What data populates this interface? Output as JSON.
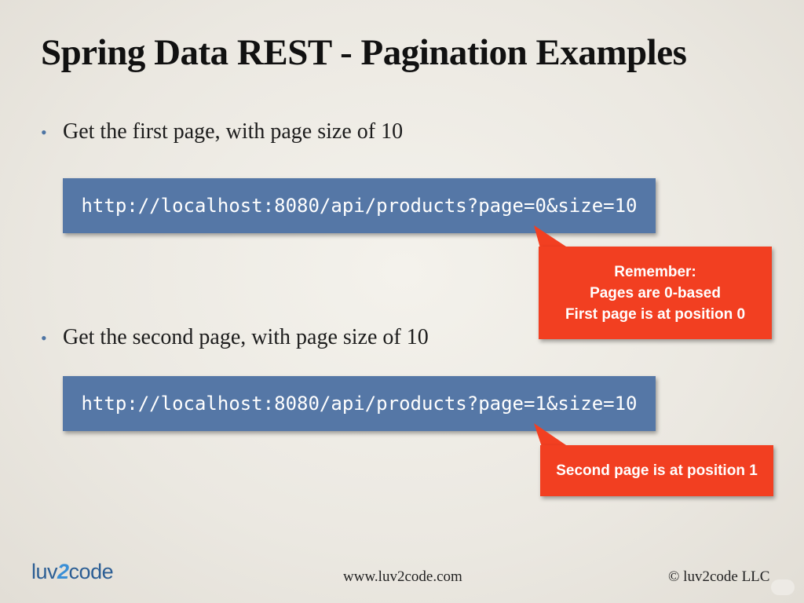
{
  "slide": {
    "title": "Spring Data REST - Pagination Examples",
    "bullets": [
      {
        "text": "Get the first page, with page size of 10",
        "url": "http://localhost:8080/api/products?page=0&size=10",
        "callout_lines": [
          "Remember:",
          "Pages are 0-based",
          "First page is at position 0"
        ]
      },
      {
        "text": "Get the second page, with page size of 10",
        "url": "http://localhost:8080/api/products?page=1&size=10",
        "callout_lines": [
          "Second page is at position 1"
        ]
      }
    ]
  },
  "footer": {
    "logo_pre": "luv",
    "logo_num": "2",
    "logo_post": "code",
    "website": "www.luv2code.com",
    "copyright": "© luv2code LLC"
  },
  "colors": {
    "url_box": "#5577a6",
    "callout": "#f23f21",
    "bullet_dot": "#4d74a3"
  },
  "icons": {
    "bullet": "•"
  }
}
